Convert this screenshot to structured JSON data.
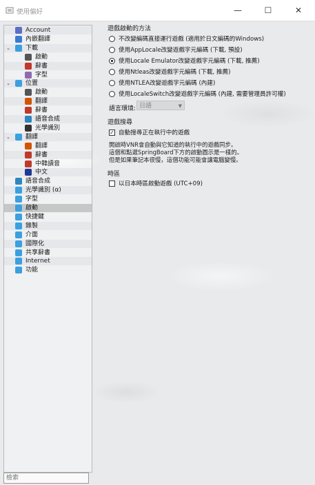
{
  "window": {
    "title": "使用偏好",
    "minimize_glyph": "—",
    "maximize_glyph": "☐",
    "close_glyph": "✕"
  },
  "sidebar": {
    "items": [
      {
        "label": "Account",
        "level": 0,
        "icon": "account-icon",
        "color": "#5b6fc4",
        "caret": "",
        "selected": false
      },
      {
        "label": "內嵌翻譯",
        "level": 0,
        "icon": "embed-translate-icon",
        "color": "#3a7bd5",
        "caret": "",
        "selected": false
      },
      {
        "label": "下載",
        "level": 0,
        "icon": "download-icon",
        "color": "#3aa0e0",
        "caret": "v",
        "selected": false
      },
      {
        "label": "啟動",
        "level": 1,
        "icon": "launch-icon",
        "color": "#555555",
        "caret": "",
        "selected": false
      },
      {
        "label": "辭書",
        "level": 1,
        "icon": "dictionary-icon",
        "color": "#c0392b",
        "caret": "",
        "selected": false
      },
      {
        "label": "字型",
        "level": 1,
        "icon": "font-icon",
        "color": "#8e6bb0",
        "caret": "",
        "selected": false
      },
      {
        "label": "位置",
        "level": 0,
        "icon": "location-icon",
        "color": "#3aa0e0",
        "caret": "v",
        "selected": false
      },
      {
        "label": "啟動",
        "level": 1,
        "icon": "launch-icon",
        "color": "#555555",
        "caret": "",
        "selected": false
      },
      {
        "label": "翻譯",
        "level": 1,
        "icon": "translate-icon",
        "color": "#d35400",
        "caret": "",
        "selected": false
      },
      {
        "label": "辭書",
        "level": 1,
        "icon": "dictionary-icon",
        "color": "#c0392b",
        "caret": "",
        "selected": false
      },
      {
        "label": "語音合成",
        "level": 1,
        "icon": "speech-icon",
        "color": "#2e86c1",
        "caret": "",
        "selected": false
      },
      {
        "label": "光學識別",
        "level": 1,
        "icon": "ocr-icon",
        "color": "#333333",
        "caret": "",
        "selected": false
      },
      {
        "label": "翻譯",
        "level": 0,
        "icon": "translation-icon",
        "color": "#3aa0e0",
        "caret": "v",
        "selected": false
      },
      {
        "label": "翻譯",
        "level": 1,
        "icon": "translate-icon",
        "color": "#d35400",
        "caret": "",
        "selected": false
      },
      {
        "label": "辭書",
        "level": 1,
        "icon": "dictionary-icon",
        "color": "#c0392b",
        "caret": "",
        "selected": false
      },
      {
        "label": "中韓讀音",
        "level": 1,
        "icon": "reading-icon",
        "color": "#c0392b",
        "caret": "",
        "selected": false
      },
      {
        "label": "中文",
        "level": 1,
        "icon": "chinese-icon",
        "color": "#1f3a93",
        "caret": "",
        "selected": false
      },
      {
        "label": "語音合成",
        "level": 0,
        "icon": "speech-icon",
        "color": "#2e86c1",
        "caret": "",
        "selected": false
      },
      {
        "label": "光學識別 (α)",
        "level": 0,
        "icon": "ocr-icon",
        "color": "#3aa0e0",
        "caret": "",
        "selected": false
      },
      {
        "label": "字型",
        "level": 0,
        "icon": "font-icon",
        "color": "#3aa0e0",
        "caret": "",
        "selected": false
      },
      {
        "label": "啟動",
        "level": 0,
        "icon": "launch-icon",
        "color": "#3aa0e0",
        "caret": "",
        "selected": true
      },
      {
        "label": "快捷鍵",
        "level": 0,
        "icon": "shortcut-icon",
        "color": "#3aa0e0",
        "caret": "",
        "selected": false
      },
      {
        "label": "錄製",
        "level": 0,
        "icon": "record-icon",
        "color": "#3aa0e0",
        "caret": "",
        "selected": false
      },
      {
        "label": "介面",
        "level": 0,
        "icon": "interface-icon",
        "color": "#3aa0e0",
        "caret": "",
        "selected": false
      },
      {
        "label": "國際化",
        "level": 0,
        "icon": "i18n-icon",
        "color": "#3aa0e0",
        "caret": "",
        "selected": false
      },
      {
        "label": "共享辭書",
        "level": 0,
        "icon": "shared-dictionary-icon",
        "color": "#3aa0e0",
        "caret": "",
        "selected": false
      },
      {
        "label": "Internet",
        "level": 0,
        "icon": "internet-icon",
        "color": "#3aa0e0",
        "caret": "",
        "selected": false
      },
      {
        "label": "功能",
        "level": 0,
        "icon": "features-icon",
        "color": "#3aa0e0",
        "caret": "",
        "selected": false
      }
    ],
    "search_placeholder": "檢索"
  },
  "launch_method": {
    "title": "遊戲啟動的方法",
    "options": [
      {
        "label": "不改變編碼直接運行遊戲 (適用於日文編碼的Windows)",
        "checked": false
      },
      {
        "label": "使用AppLocale改變遊戲字元編碼 (下載, 預設)",
        "checked": false
      },
      {
        "label": "使用Locale Emulator改變遊戲字元編碼 (下載, 推薦)",
        "checked": true
      },
      {
        "label": "使用Ntleas改變遊戲字元編碼 (下載, 推薦)",
        "checked": false
      },
      {
        "label": "使用NTLEA改變遊戲字元編碼 (內建)",
        "checked": false
      },
      {
        "label": "使用LocaleSwitch改變遊戲字元編碼 (內建, 需要管理員許可權)",
        "checked": false
      }
    ],
    "language_label": "語言環境:",
    "language_value": "日語"
  },
  "game_detect": {
    "title": "遊戲搜尋",
    "checkbox_label": "自動搜尋正在執行中的遊戲",
    "checked": true,
    "description": [
      "開啟時VNR會自動與它知道的執行中的遊戲同步。",
      "這個和點選SpringBoard下方的啟動圖示是一樣的。",
      "但是如果筆記本很慢，這個功能可能會讓電腦變慢。"
    ]
  },
  "timezone": {
    "title": "時區",
    "checkbox_label": "以日本時區啟動遊戲 (UTC+09)",
    "checked": false
  }
}
